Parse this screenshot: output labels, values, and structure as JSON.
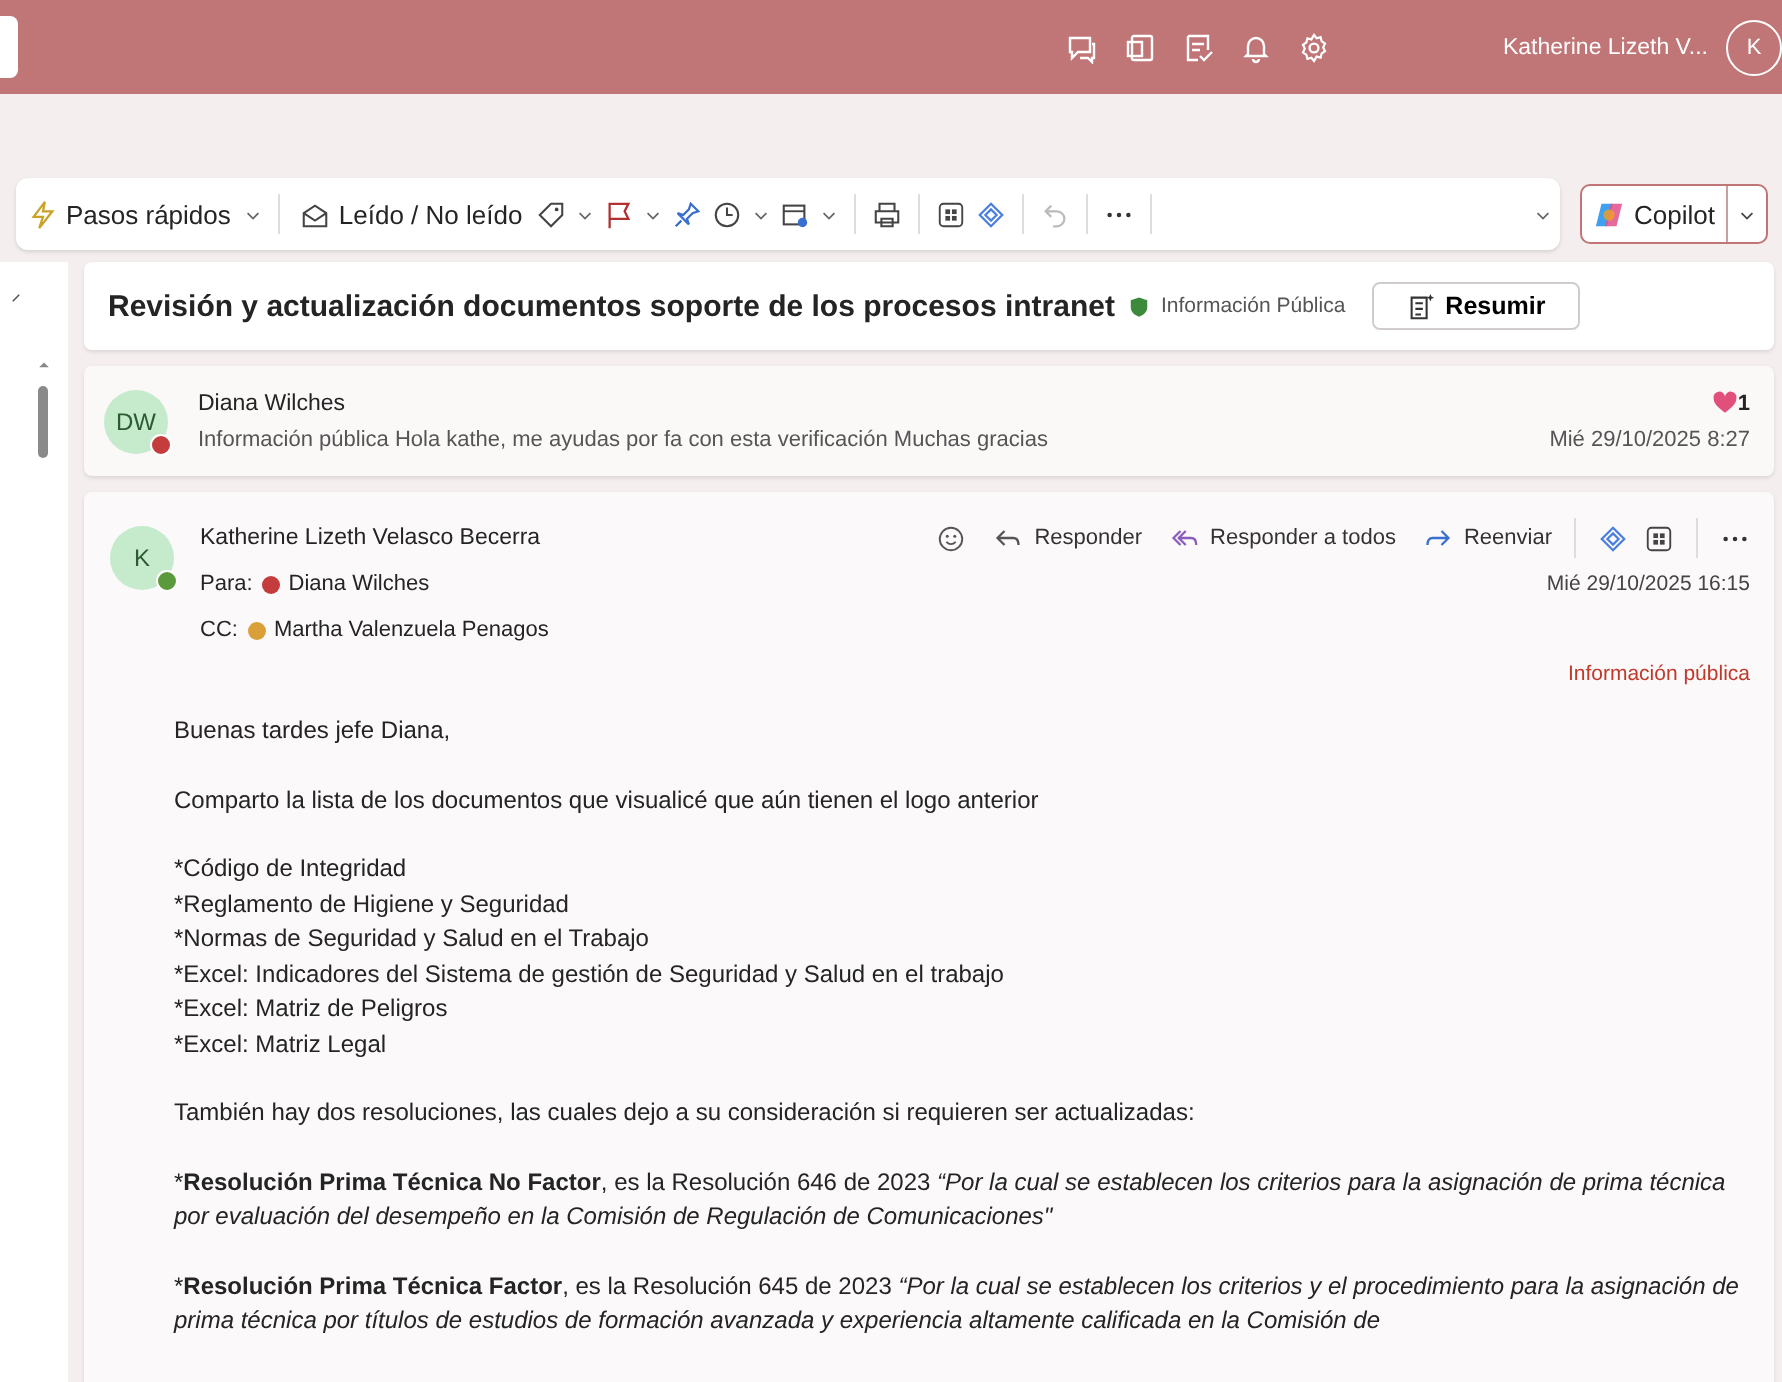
{
  "header": {
    "user_name": "Katherine Lizeth V...",
    "avatar_initial": "K"
  },
  "toolbar": {
    "quick_steps": "Pasos rápidos",
    "read_toggle": "Leído / No leído",
    "copilot": "Copilot"
  },
  "subject": {
    "title": "Revisión y actualización documentos soporte de los procesos intranet",
    "sensitivity": "Información Pública",
    "summarize": "Resumir"
  },
  "collapsed_message": {
    "initials": "DW",
    "color": "#c43c3c",
    "sender": "Diana Wilches",
    "preview": "Información pública Hola kathe, me ayudas por fa con esta verificación Muchas gracias",
    "reactions": "1",
    "date": "Mié 29/10/2025 8:27"
  },
  "message": {
    "initials": "K",
    "color": "#5a9a3c",
    "sender": "Katherine Lizeth Velasco Becerra",
    "actions": [
      {
        "kind": "reply",
        "label": "Responder"
      },
      {
        "kind": "reply-all",
        "label": "Responder a todos"
      },
      {
        "kind": "forward",
        "label": "Reenviar"
      }
    ],
    "to_label": "Para:",
    "to": {
      "name": "Diana Wilches",
      "color": "#c43c3c"
    },
    "cc_label": "CC:",
    "cc": {
      "name": "Martha Valenzuela Penagos",
      "color": "#d9a03a"
    },
    "date": "Mié 29/10/2025 16:15",
    "sensitivity": "Información pública",
    "body": [
      {
        "kind": "text",
        "text": "Buenas tardes jefe Diana,"
      },
      {
        "kind": "text",
        "text": "Comparto la lista de los documentos que visualicé que aún tienen el logo anterior"
      },
      {
        "kind": "list",
        "lines": [
          "*Código de Integridad",
          "*Reglamento de Higiene y Seguridad",
          "*Normas de Seguridad y Salud en el Trabajo",
          "*Excel: Indicadores del Sistema de gestión de Seguridad y Salud en el trabajo",
          "*Excel: Matriz de Peligros",
          "*Excel: Matriz Legal"
        ]
      },
      {
        "kind": "text",
        "text": "También hay dos resoluciones, las cuales dejo a su consideración si requieren ser actualizadas:"
      },
      {
        "kind": "resolution",
        "prefix": "*",
        "title": "Resolución Prima Técnica No Factor",
        "middle": ", es la Resolución 646 de 2023 ",
        "quote": "“Por la cual se establecen los criterios para la asignación de prima técnica por evaluación del desempeño en la Comisión de Regulación de Comunicaciones\""
      },
      {
        "kind": "resolution",
        "prefix": "*",
        "title": "Resolución Prima Técnica Factor",
        "middle": ", es la Resolución 645 de 2023 ",
        "quote": "“Por la cual se establecen los criterios y el procedimiento para la asignación de prima técnica por títulos de estudios de formación avanzada y experiencia altamente calificada en la Comisión de"
      }
    ]
  }
}
